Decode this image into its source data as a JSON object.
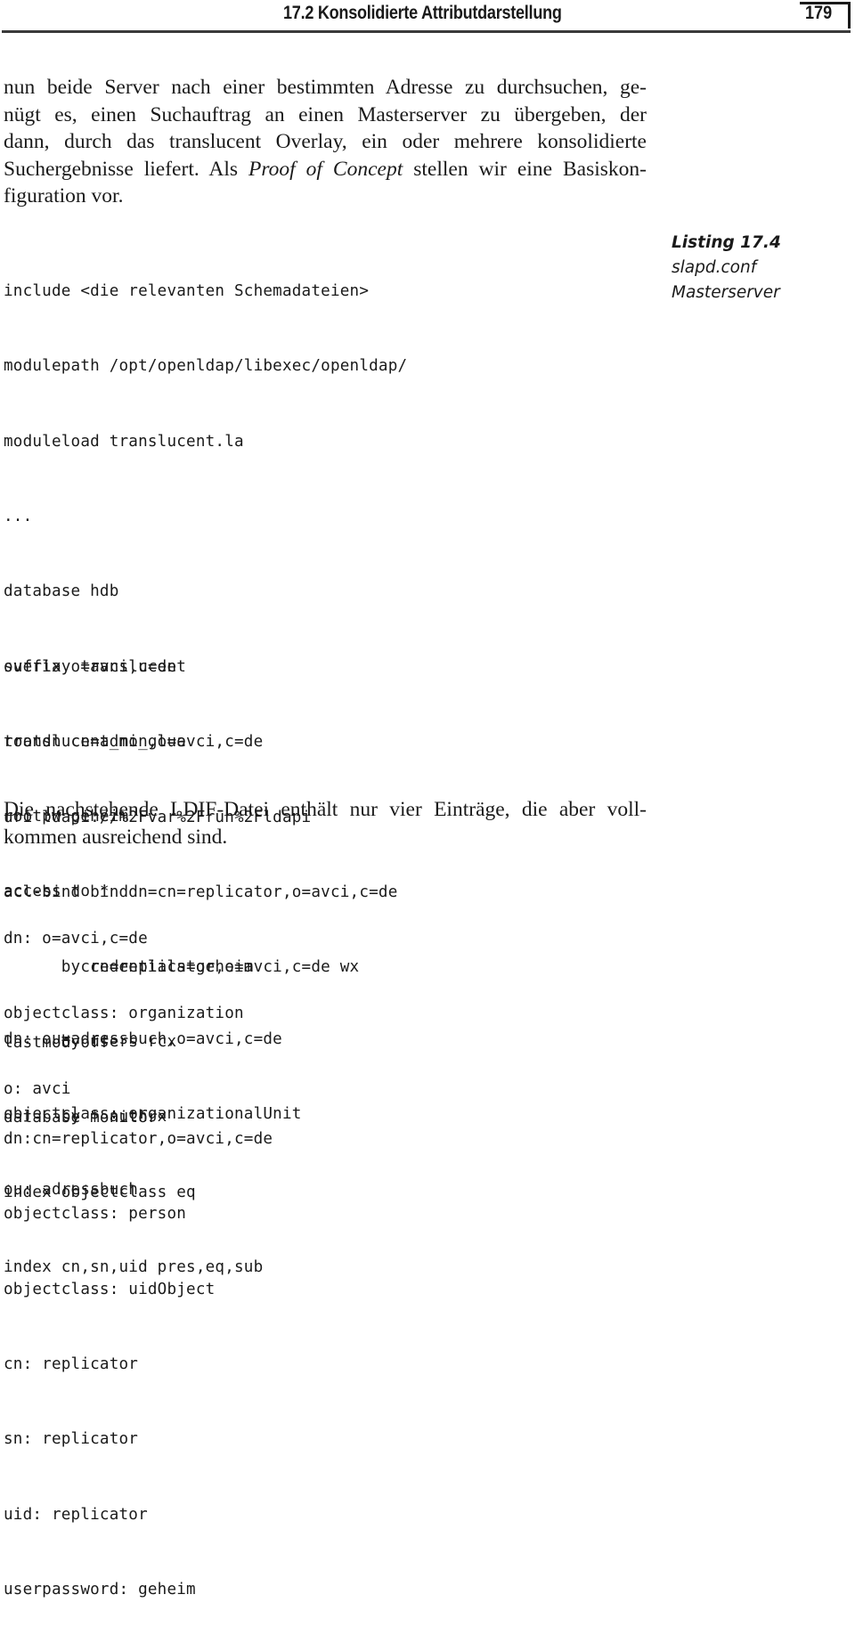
{
  "header": {
    "section_title": "17.2 Konsolidierte Attributdarstellung",
    "page_number": "179"
  },
  "intro_paragraph": {
    "lines": [
      "nun beide Server nach einer bestimmten Adresse zu durchsuchen, ge-",
      "nügt es, einen Suchauftrag an einen Masterserver zu übergeben, der",
      "dann, durch das translucent Overlay, ein oder mehrere konsolidierte"
    ],
    "line4_before": "Suchergebnisse liefert. Als ",
    "line4_italic": "Proof of Concept",
    "line4_after": " stellen wir eine Basiskon-",
    "line5": "figuration vor."
  },
  "listing_caption": {
    "number": "Listing 17.4",
    "file": "slapd.conf",
    "subject": "Masterserver"
  },
  "config_listing": {
    "block1": [
      "include <die relevanten Schemadateien>",
      "modulepath /opt/openldap/libexec/openldap/",
      "moduleload translucent.la",
      "...",
      "database hdb",
      "suffix o=avci,c=de",
      "rootdn cn=admin,o=avci,c=de",
      "rootpw geheim",
      "access to *",
      "      by cn=replicator,o=avci,c=de wx",
      "      by users rcx",
      "      by * auth x",
      "index objectclass eq",
      "index cn,sn,uid pres,eq,sub"
    ],
    "block2": [
      "overlay translucent",
      "translucent_no_glue",
      "uri ldapi://%2Fvar%2Frun%2Fldapi",
      "acl-bind binddn=cn=replicator,o=avci,c=de",
      "        credentials=geheim",
      "lastmod off",
      "database monitor"
    ]
  },
  "ldif_paragraph": {
    "line1": "Die nachstehende LDIF-Datei enthält nur vier Einträge, die aber voll-",
    "line2": "kommen ausreichend sind."
  },
  "ldif_listing": {
    "entry1": [
      "dn: o=avci,c=de",
      "objectclass: organization",
      "o: avci"
    ],
    "entry2": [
      "dn: ou=adressbuch,o=avci,c=de",
      "objectclass: organizationalUnit",
      "ou: adressbuch"
    ],
    "entry3": [
      "dn:cn=replicator,o=avci,c=de",
      "objectclass: person",
      "objectclass: uidObject",
      "cn: replicator",
      "sn: replicator",
      "uid: replicator",
      "userpassword: geheim"
    ]
  }
}
